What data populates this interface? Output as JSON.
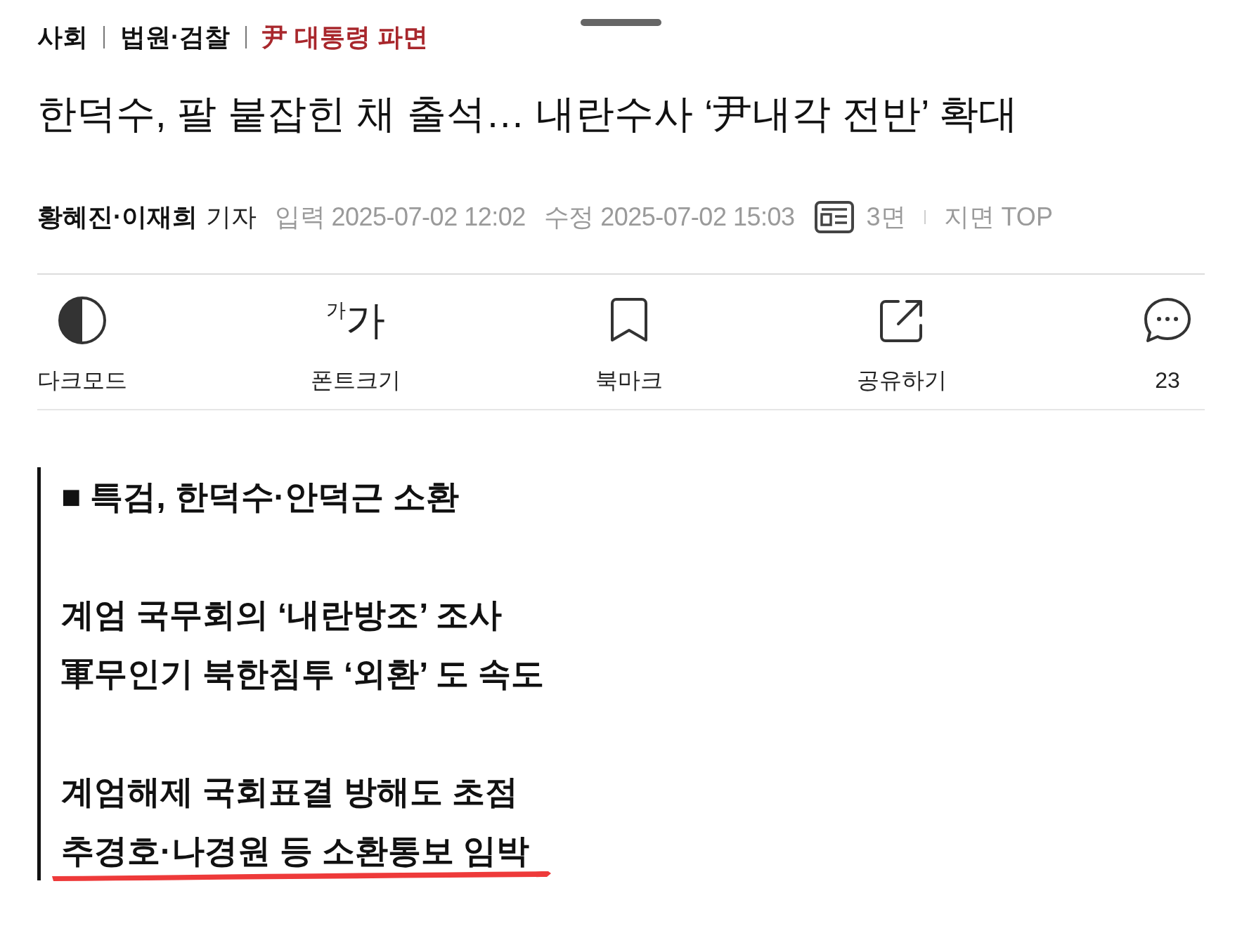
{
  "breadcrumb": [
    {
      "label": "사회",
      "highlighted": false
    },
    {
      "label": "법원·검찰",
      "highlighted": false
    },
    {
      "label": "尹 대통령 파면",
      "highlighted": true
    }
  ],
  "headline": "한덕수, 팔 붙잡힌 채 출석… 내란수사 ‘尹내각 전반’ 확대",
  "byline": {
    "reporters": "황혜진·이재희",
    "role": "기자",
    "entered": "입력 2025-07-02 12:02",
    "modified": "수정 2025-07-02 15:03",
    "print_page": "3면",
    "print_position": "지면 TOP"
  },
  "toolbar": [
    {
      "kind": "dark_mode",
      "label": "다크모드"
    },
    {
      "kind": "font_size",
      "label": "폰트크기",
      "glyph_small": "가",
      "glyph_large": "가"
    },
    {
      "kind": "bookmark",
      "label": "북마크"
    },
    {
      "kind": "share",
      "label": "공유하기"
    },
    {
      "kind": "comments",
      "label": "23"
    }
  ],
  "summary": {
    "paragraphs": [
      [
        {
          "text": "■ 특검, 한덕수·안덕근 소환",
          "underlined": false
        }
      ],
      [
        {
          "text": "계엄 국무회의 ‘내란방조’ 조사",
          "underlined": false
        },
        {
          "text": "軍무인기 북한침투 ‘외환’ 도 속도",
          "underlined": false
        }
      ],
      [
        {
          "text": "계엄해제 국회표결 방해도 초점",
          "underlined": false
        },
        {
          "text": "추경호·나경원 등 소환통보 임박",
          "underlined": true
        }
      ]
    ]
  }
}
